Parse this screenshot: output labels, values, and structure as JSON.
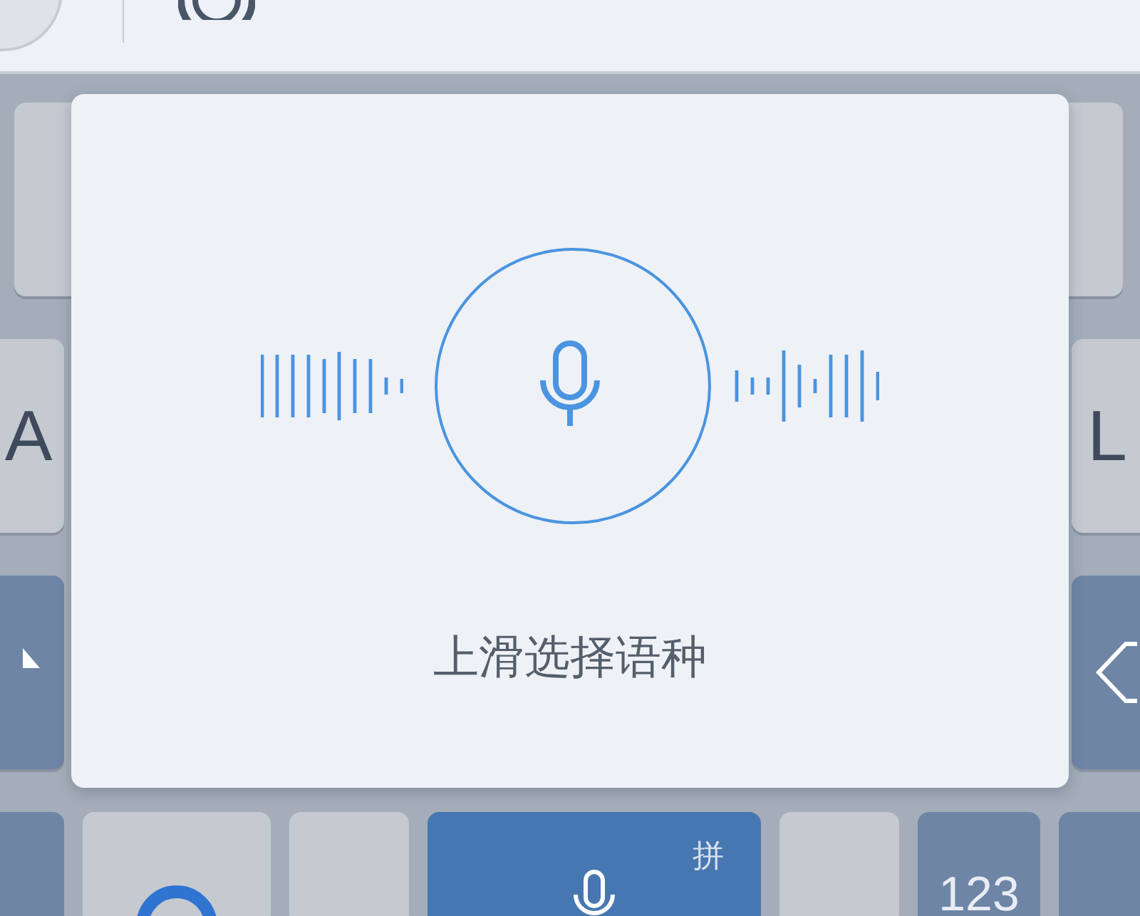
{
  "keyboard": {
    "rows": [
      [
        {
          "kind": "blank"
        },
        {
          "kind": "blank"
        }
      ],
      [
        {
          "kind": "letter",
          "label": "A"
        },
        {
          "kind": "letter",
          "label": "L"
        }
      ],
      [
        {
          "kind": "shift"
        },
        {
          "kind": "backspace"
        }
      ],
      [
        {
          "kind": "dark"
        },
        {
          "kind": "logo"
        },
        {
          "kind": "blank"
        },
        {
          "kind": "space",
          "label": "拼"
        },
        {
          "kind": "blank"
        },
        {
          "kind": "dark",
          "label": "123"
        },
        {
          "kind": "dark"
        }
      ]
    ]
  },
  "voice_popup": {
    "hint": "上滑选择语种"
  }
}
